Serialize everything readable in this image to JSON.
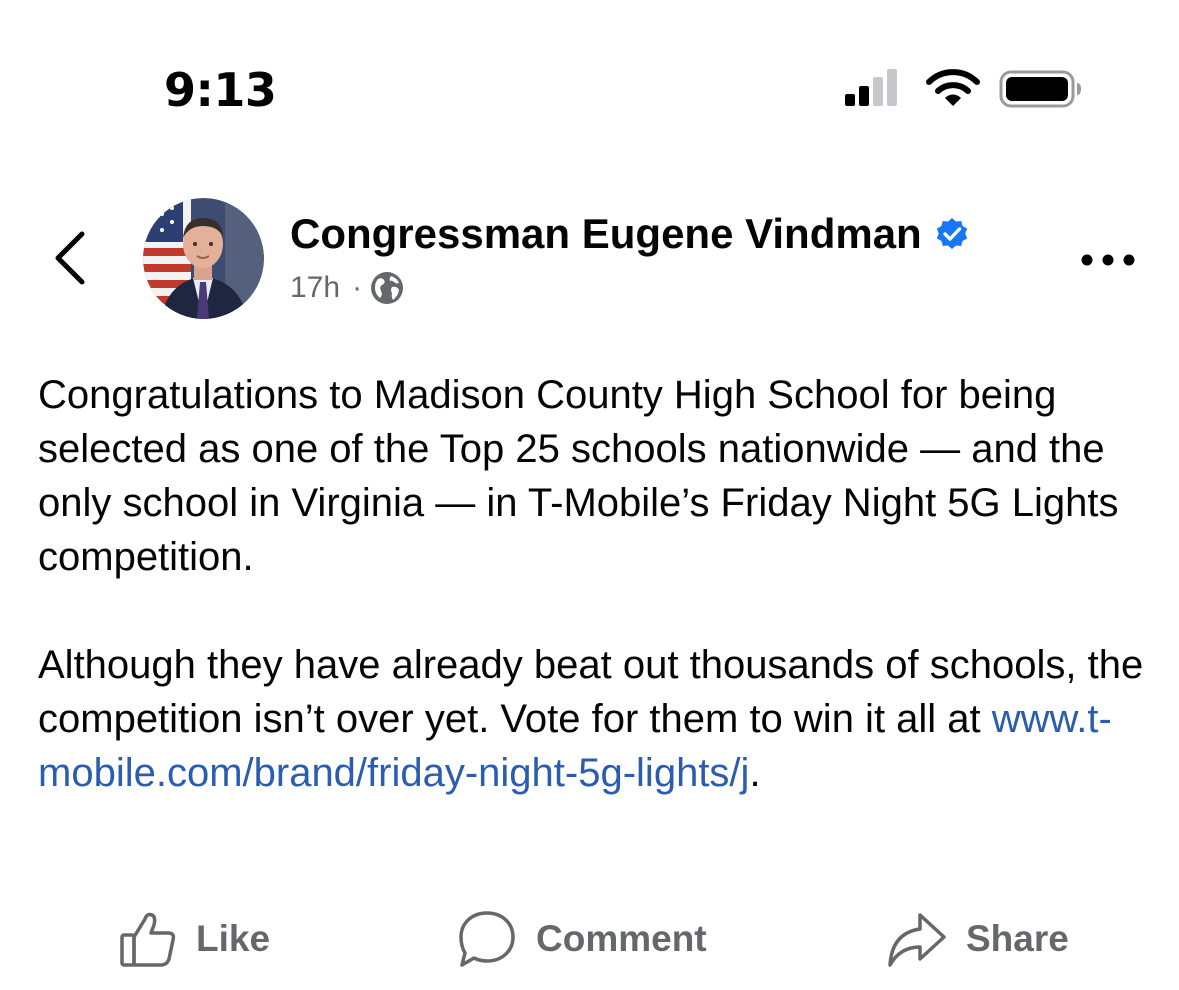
{
  "status_bar": {
    "time": "9:13",
    "icons": [
      "cellular-signal-icon",
      "wifi-icon",
      "battery-icon"
    ]
  },
  "post": {
    "author": {
      "name": "Congressman Eugene Vindman",
      "verified": true
    },
    "meta": {
      "time": "17h",
      "separator": "·",
      "audience_icon": "globe-icon"
    },
    "body": {
      "paragraph_1": "Congratulations to Madison County High School for being selected as one of the Top 25 schools nationwide — and the only school in Virginia — in T-Mobile’s Friday Night 5G Lights competition.",
      "paragraph_2_text": "Although they have already beat out thousands of schools, the competition isn’t over yet. Vote for them to win it all at ",
      "paragraph_2_link": "www.t-mobile.com/brand/friday-night-5g-lights/j",
      "paragraph_2_end": "."
    }
  },
  "actions": {
    "like": "Like",
    "comment": "Comment",
    "share": "Share"
  },
  "colors": {
    "link": "#2a5db0",
    "secondary_text": "#65676b",
    "verified": "#1877f2"
  }
}
